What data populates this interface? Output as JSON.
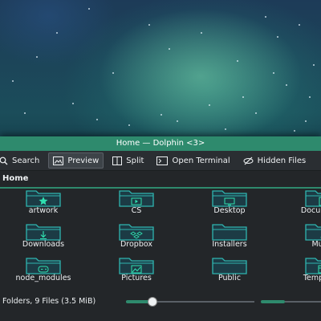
{
  "window": {
    "title": "Home — Dolphin <3>"
  },
  "toolbar": {
    "search_label": "Search",
    "preview_label": "Preview",
    "split_label": "Split",
    "open_terminal_label": "Open Terminal",
    "hidden_files_label": "Hidden Files"
  },
  "location": {
    "path": "Home"
  },
  "items": [
    {
      "name": "artwork",
      "icon": "star-icon"
    },
    {
      "name": "CS",
      "icon": "play-icon"
    },
    {
      "name": "Desktop",
      "icon": "desktop-icon"
    },
    {
      "name": "Documents",
      "icon": "document-icon"
    },
    {
      "name": "Downloads",
      "icon": "download-icon"
    },
    {
      "name": "Dropbox",
      "icon": "dropbox-icon"
    },
    {
      "name": "Installers",
      "icon": "folder-icon"
    },
    {
      "name": "Music",
      "icon": "music-icon"
    },
    {
      "name": "node_modules",
      "icon": "gamepad-icon"
    },
    {
      "name": "Pictures",
      "icon": "image-icon"
    },
    {
      "name": "Public",
      "icon": "folder-icon"
    },
    {
      "name": "Templates",
      "icon": "template-icon"
    }
  ],
  "status": {
    "summary": "Folders, 9 Files (3.5 MiB)",
    "zoom_level": 0.2
  },
  "colors": {
    "accent": "#2e8a6d",
    "folder": "#2fb5b0",
    "background": "#232629"
  }
}
